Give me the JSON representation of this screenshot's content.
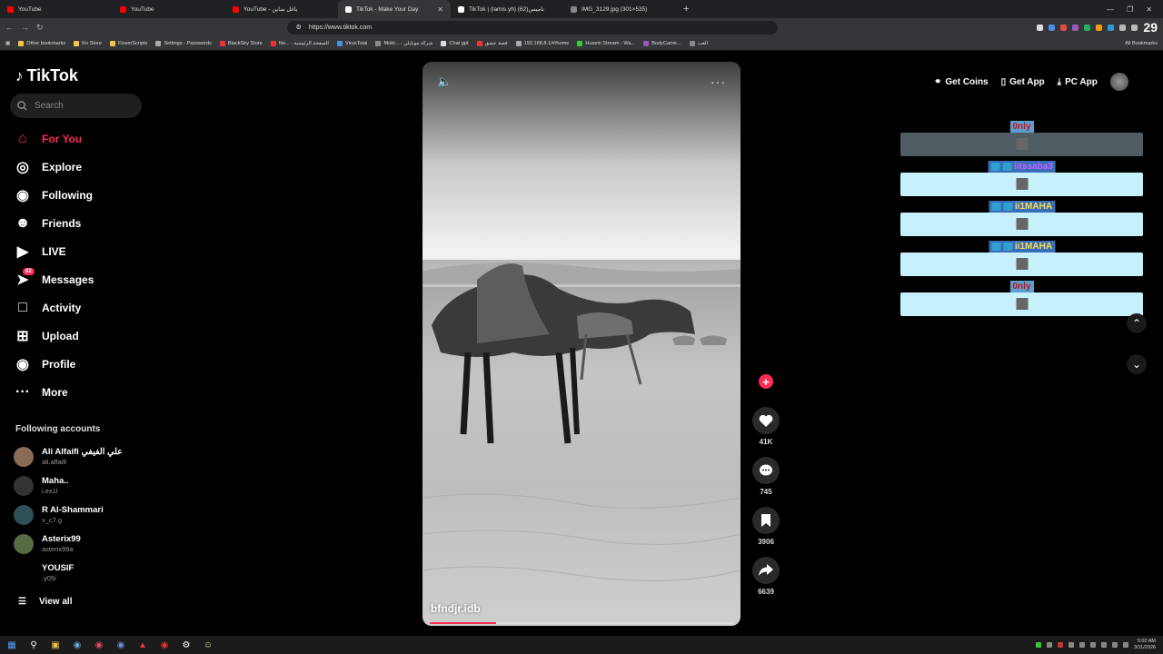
{
  "browser": {
    "tabs": [
      {
        "title": "YouTube",
        "color": "#ff0000"
      },
      {
        "title": "YouTube",
        "color": "#ff0000"
      },
      {
        "title": "YouTube - ياغل ساين",
        "color": "#ff0000"
      },
      {
        "title": "TikTok - Make Your Day",
        "color": "#ffffff",
        "active": true
      },
      {
        "title": "TikTok | (lamis.yh) (62)نامیس",
        "color": "#ffffff"
      },
      {
        "title": "IMG_3129.jpg (301×535)",
        "color": "#888888"
      }
    ],
    "url": "https://www.tiktok.com",
    "clock_badge": "29",
    "bookmarks": [
      "Other bookmarks",
      "Ko Store",
      "FivemScripts",
      "Settings - Passwords",
      "BlackSky Store",
      "Ne... - الصفحة الرئيسية",
      "VirusTotal",
      "Mobi... - شركة موبايلي",
      "Chat gpt",
      "قصة عشق",
      "192.168.8.1/#/home",
      "Husein Stream - Wa...",
      "BodyCame...",
      "العب"
    ],
    "all_bookmarks": "All Bookmarks"
  },
  "sidebar": {
    "logo": "TikTok",
    "search_placeholder": "Search",
    "nav": [
      {
        "label": "For You",
        "icon": "home-icon"
      },
      {
        "label": "Explore",
        "icon": "compass-icon"
      },
      {
        "label": "Following",
        "icon": "following-icon"
      },
      {
        "label": "Friends",
        "icon": "friends-icon"
      },
      {
        "label": "LIVE",
        "icon": "live-icon"
      },
      {
        "label": "Messages",
        "icon": "messages-icon",
        "badge": "62"
      },
      {
        "label": "Activity",
        "icon": "activity-icon"
      },
      {
        "label": "Upload",
        "icon": "upload-icon"
      },
      {
        "label": "Profile",
        "icon": "profile-icon"
      },
      {
        "label": "More",
        "icon": "more-icon"
      }
    ],
    "following_title": "Following accounts",
    "accounts": [
      {
        "name": "Ali Alfaifi علي الفيفي",
        "handle": "ali.alfaifi",
        "color": "#8a6b55"
      },
      {
        "name": "Maha..",
        "handle": "i.ex1l",
        "color": "#333333"
      },
      {
        "name": "R Al-Shammari",
        "handle": "v_c7.g",
        "color": "#2d4f55"
      },
      {
        "name": "Asterix99",
        "handle": "asterix99a",
        "color": "#556b45"
      },
      {
        "name": "YOUSIF",
        "handle": ".y05i",
        "color": "#000000"
      }
    ],
    "view_all": "View all"
  },
  "video": {
    "author": "bfndjr.idb",
    "progress": 0.22
  },
  "actions": {
    "likes": "41K",
    "comments": "745",
    "saves": "3906",
    "shares": "6639"
  },
  "topbar": {
    "get_coins": "Get Coins",
    "get_app": "Get App",
    "pc_app": "PC App"
  },
  "overlay": [
    {
      "name": "0nly",
      "style": "red",
      "bar": "dark"
    },
    {
      "name": "iitssaba3",
      "style": "purple",
      "bar": "light"
    },
    {
      "name": "ii1MAHA",
      "style": "blue",
      "bar": "light"
    },
    {
      "name": "ii1MAHA",
      "style": "blue",
      "bar": "light"
    },
    {
      "name": "0nly",
      "style": "red",
      "bar": "light"
    }
  ],
  "taskbar": {
    "time": "5:02 AM",
    "date": "3/11/2026"
  }
}
